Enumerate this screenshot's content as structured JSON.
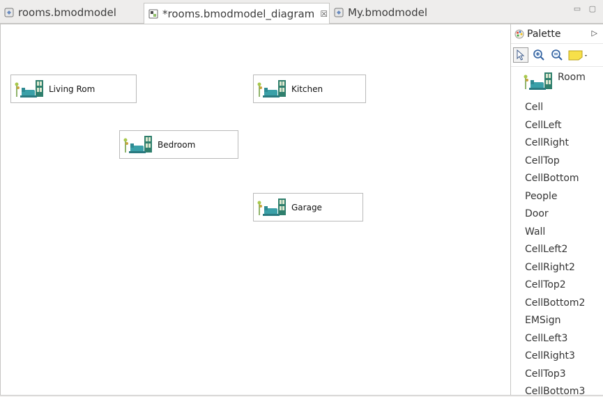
{
  "tabs": [
    {
      "label": "rooms.bmodmodel",
      "active": false
    },
    {
      "label": "*rooms.bmodmodel_diagram",
      "active": true,
      "close": "☒"
    },
    {
      "label": "My.bmodmodel",
      "active": false
    }
  ],
  "window_controls": "▭ ▢",
  "diagram": {
    "nodes": [
      {
        "label": "Living Rom"
      },
      {
        "label": "Kitchen"
      },
      {
        "label": "Bedroom"
      },
      {
        "label": "Garage"
      }
    ]
  },
  "palette": {
    "title": "Palette",
    "expand_glyph": "▷",
    "room_label": "Room",
    "items": [
      "Cell",
      "CellLeft",
      "CellRight",
      "CellTop",
      "CellBottom",
      "People",
      "Door",
      "Wall",
      "CellLeft2",
      "CellRight2",
      "CellTop2",
      "CellBottom2",
      "EMSign",
      "CellLeft3",
      "CellRight3",
      "CellTop3",
      "CellBottom3"
    ]
  }
}
